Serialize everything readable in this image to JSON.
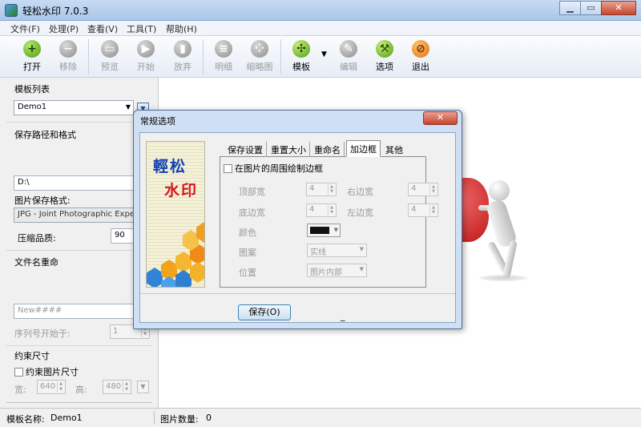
{
  "window": {
    "title": "轻松水印 7.0.3",
    "min_label": "▁",
    "max_label": "▭",
    "close_label": "✕"
  },
  "menu": [
    "文件(F)",
    "处理(P)",
    "查看(V)",
    "工具(T)",
    "帮助(H)"
  ],
  "toolbar": {
    "open": "打开",
    "remove": "移除",
    "preview": "预览",
    "start": "开始",
    "abort": "放弃",
    "detail": "明细",
    "thumbnail": "缩略图",
    "template": "模板",
    "edit": "编辑",
    "options": "选项",
    "exit": "退出"
  },
  "left_panel": {
    "template_list_label": "模板列表",
    "template_selected": "Demo1",
    "save_path_label": "保存路径和格式",
    "save_path_value": "D:\\",
    "format_label": "图片保存格式:",
    "format_value": "JPG - Joint Photographic Experts",
    "quality_label": "压缩品质:",
    "quality_value": "90",
    "rename_label": "文件名重命",
    "rename_placeholder": "New####",
    "seq_label": "序列号开始于:",
    "seq_value": "1",
    "constraint_label": "约束尺寸",
    "constraint_check": "约束图片尺寸",
    "width_label": "宽:",
    "width_value": "640",
    "height_label": "高:",
    "height_value": "480"
  },
  "status": {
    "template_name_label": "模板名称:",
    "template_name_value": "Demo1",
    "image_count_label": "图片数量:",
    "image_count_value": "0"
  },
  "dialog": {
    "title": "常规选项",
    "close_label": "✕",
    "banner_line1": "輕松",
    "banner_line2": "水印",
    "tabs": [
      "保存设置",
      "重置大小",
      "重命名",
      "加边框",
      "其他"
    ],
    "active_tab": "加边框",
    "draw_border_label": "在图片的周围绘制边框",
    "top_label": "顶部宽",
    "top_value": "4",
    "right_label": "右边宽",
    "right_value": "4",
    "bottom_label": "底边宽",
    "bottom_value": "4",
    "left_label": "左边宽",
    "left_value": "4",
    "color_label": "颜色",
    "color_value": "#111111",
    "pattern_label": "图案",
    "pattern_value": "实线",
    "position_label": "位置",
    "position_value": "图片内部",
    "save_button": "保存(O)",
    "underscore": "_"
  }
}
